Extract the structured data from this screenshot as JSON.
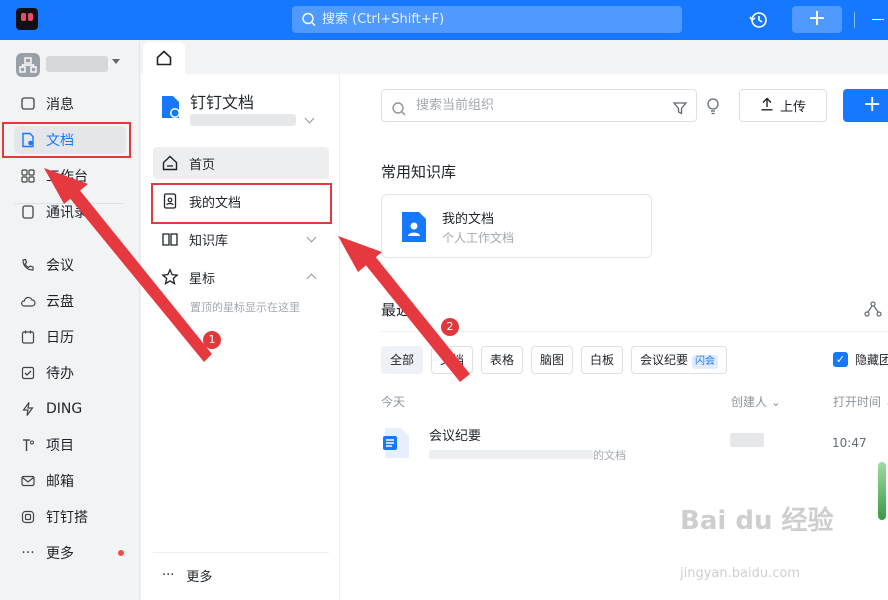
{
  "topbar": {
    "search_placeholder": "搜索 (Ctrl+Shift+F)",
    "add_label": "+"
  },
  "nav": {
    "items": [
      {
        "label": "消息",
        "icon": "message-icon"
      },
      {
        "label": "文档",
        "icon": "document-icon",
        "active": true
      },
      {
        "label": "工作台",
        "icon": "grid-icon"
      },
      {
        "label": "通讯录",
        "icon": "contacts-icon"
      },
      {
        "label": "会议",
        "icon": "phone-icon"
      },
      {
        "label": "云盘",
        "icon": "cloud-icon"
      },
      {
        "label": "日历",
        "icon": "calendar-icon"
      },
      {
        "label": "待办",
        "icon": "checkbox-icon"
      },
      {
        "label": "DING",
        "icon": "lightning-icon"
      },
      {
        "label": "项目",
        "icon": "project-icon"
      },
      {
        "label": "邮箱",
        "icon": "mail-icon"
      },
      {
        "label": "钉钉搭",
        "icon": "dingda-icon"
      },
      {
        "label": "更多",
        "icon": "ellipsis-icon"
      }
    ]
  },
  "docs_sidebar": {
    "title": "钉钉文档",
    "items": [
      {
        "label": "首页"
      },
      {
        "label": "我的文档"
      },
      {
        "label": "知识库"
      },
      {
        "label": "星标"
      }
    ],
    "star_hint": "置顶的星标显示在这里",
    "more_label": "更多"
  },
  "main": {
    "search_placeholder": "搜索当前组织",
    "upload_label": "上传",
    "new_label": "+",
    "kb_section_title": "常用知识库",
    "kb_card": {
      "name": "我的文档",
      "desc": "个人工作文档"
    },
    "recent_title": "最近",
    "filters": [
      "全部",
      "文档",
      "表格",
      "脑图",
      "白板",
      "会议纪要"
    ],
    "flash_badge": "闪会",
    "hide_label": "隐藏团",
    "columns": {
      "today": "今天",
      "creator": "创建人",
      "opened": "打开时间"
    },
    "rows": [
      {
        "name": "会议纪要",
        "path_suffix": "的文档",
        "time": "10:47"
      }
    ]
  },
  "annotations": {
    "badge1": "1",
    "badge2": "2",
    "accent": "#e5393f"
  },
  "watermark": {
    "text": "Bai du 经验",
    "sub": "jingyan.baidu.com"
  }
}
